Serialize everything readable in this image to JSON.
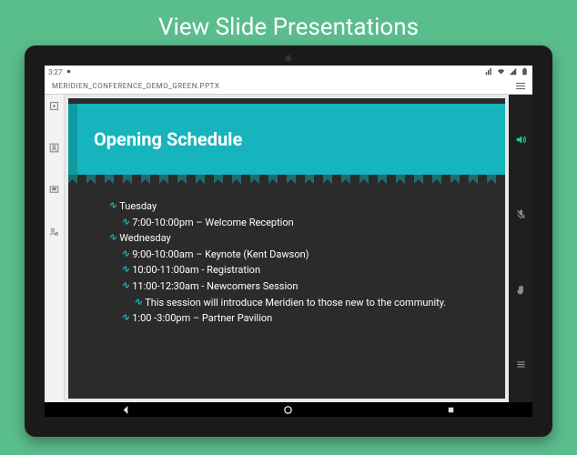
{
  "promo": {
    "headline": "View Slide Presentations"
  },
  "status": {
    "time": "3:27",
    "net_icon": "lte-icon",
    "wifi_icon": "wifi-icon",
    "sig_icon": "signal-icon",
    "batt_icon": "battery-icon"
  },
  "file": {
    "name": "MERIDIEN_CONFERENCE_DEMO_GREEN.PPTX"
  },
  "leftrail": [
    {
      "name": "expand-icon"
    },
    {
      "name": "person-box-icon"
    },
    {
      "name": "screen-share-icon"
    },
    {
      "name": "person-gear-icon"
    }
  ],
  "rightrail": [
    {
      "name": "volume-icon",
      "active": true
    },
    {
      "name": "mic-off-icon",
      "active": false
    },
    {
      "name": "raise-hand-icon",
      "active": false
    },
    {
      "name": "menu-icon",
      "active": false
    }
  ],
  "slide": {
    "title": "Opening Schedule",
    "items": [
      {
        "level": 0,
        "text": "Tuesday"
      },
      {
        "level": 1,
        "text": "7:00-10:00pm – Welcome Reception"
      },
      {
        "level": 0,
        "text": "Wednesday"
      },
      {
        "level": 1,
        "text": "9:00-10:00am – Keynote (Kent Dawson)"
      },
      {
        "level": 1,
        "text": "10:00-11:00am - Registration"
      },
      {
        "level": 1,
        "text": "11:00-12:30am - Newcomers Session"
      },
      {
        "level": 2,
        "text": "This session will introduce Meridien to those new to the community."
      },
      {
        "level": 1,
        "text": "1:00 -3:00pm – Partner Pavilion"
      }
    ]
  },
  "nav": {
    "back": "back-icon",
    "home": "home-icon",
    "recent": "recent-icon"
  },
  "colors": {
    "bg": "#5abd8c",
    "accent": "#16b4bc",
    "slide_bg": "#2b2b2b"
  }
}
